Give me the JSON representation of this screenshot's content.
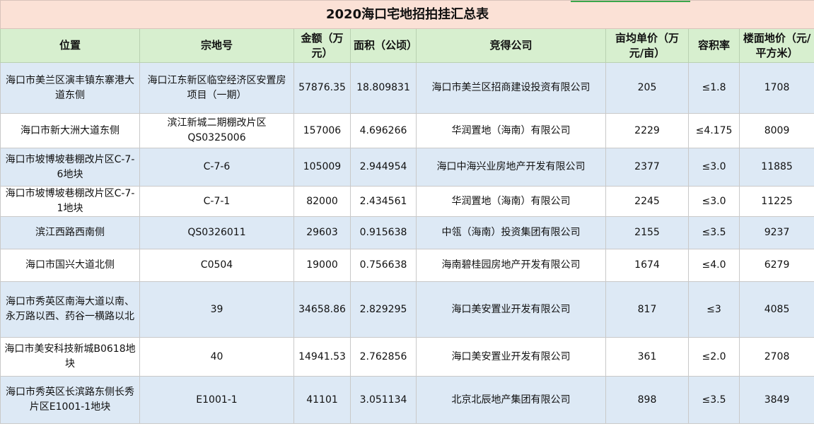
{
  "title": "2020海口宅地招拍挂汇总表",
  "headers": {
    "location": "位置",
    "parcel": "宗地号",
    "amount": "金额（万元）",
    "area": "面积（公顷）",
    "company": "竞得公司",
    "unit_price": "亩均单价（万元/亩）",
    "plot_ratio": "容积率",
    "floor_price": "楼面地价（元/平方米）"
  },
  "rows": [
    {
      "location": "海口市美兰区演丰镇东寨港大道东侧",
      "parcel": "海口江东新区临空经济区安置房项目（一期）",
      "amount": "57876.35",
      "area": "18.809831",
      "company": "海口市美兰区招商建设投资有限公司",
      "unit_price": "205",
      "plot_ratio": "≤1.8",
      "floor_price": "1708"
    },
    {
      "location": "海口市新大洲大道东侧",
      "parcel": "滨江新城二期棚改片区QS0325006",
      "amount": "157006",
      "area": "4.696266",
      "company": "华润置地（海南）有限公司",
      "unit_price": "2229",
      "plot_ratio": "≤4.175",
      "floor_price": "8009"
    },
    {
      "location": "海口市坡博坡巷棚改片区C-7-6地块",
      "parcel": "C-7-6",
      "amount": "105009",
      "area": "2.944954",
      "company": "海口中海兴业房地产开发有限公司",
      "unit_price": "2377",
      "plot_ratio": "≤3.0",
      "floor_price": "11885"
    },
    {
      "location": "海口市坡博坡巷棚改片区C-7-1地块",
      "parcel": "C-7-1",
      "amount": "82000",
      "area": "2.434561",
      "company": "华润置地（海南）有限公司",
      "unit_price": "2245",
      "plot_ratio": "≤3.0",
      "floor_price": "11225"
    },
    {
      "location": "滨江西路西南侧",
      "parcel": "QS0326011",
      "amount": "29603",
      "area": "0.915638",
      "company": "中瓴（海南）投资集团有限公司",
      "unit_price": "2155",
      "plot_ratio": "≤3.5",
      "floor_price": "9237"
    },
    {
      "location": "海口市国兴大道北侧",
      "parcel": "C0504",
      "amount": "19000",
      "area": "0.756638",
      "company": "海南碧桂园房地产开发有限公司",
      "unit_price": "1674",
      "plot_ratio": "≤4.0",
      "floor_price": "6279"
    },
    {
      "location": "海口市秀英区南海大道以南、永万路以西、药谷一横路以北",
      "parcel": "39",
      "amount": "34658.86",
      "area": "2.829295",
      "company": "海口美安置业开发有限公司",
      "unit_price": "817",
      "plot_ratio": "≤3",
      "floor_price": "4085"
    },
    {
      "location": "海口市美安科技新城B0618地块",
      "parcel": "40",
      "amount": "14941.53",
      "area": "2.762856",
      "company": "海口美安置业开发有限公司",
      "unit_price": "361",
      "plot_ratio": "≤2.0",
      "floor_price": "2708"
    },
    {
      "location": "海口市秀英区长滨路东侧长秀片区E1001-1地块",
      "parcel": "E1001-1",
      "amount": "41101",
      "area": "3.051134",
      "company": "北京北辰地产集团有限公司",
      "unit_price": "898",
      "plot_ratio": "≤3.5",
      "floor_price": "3849"
    }
  ]
}
